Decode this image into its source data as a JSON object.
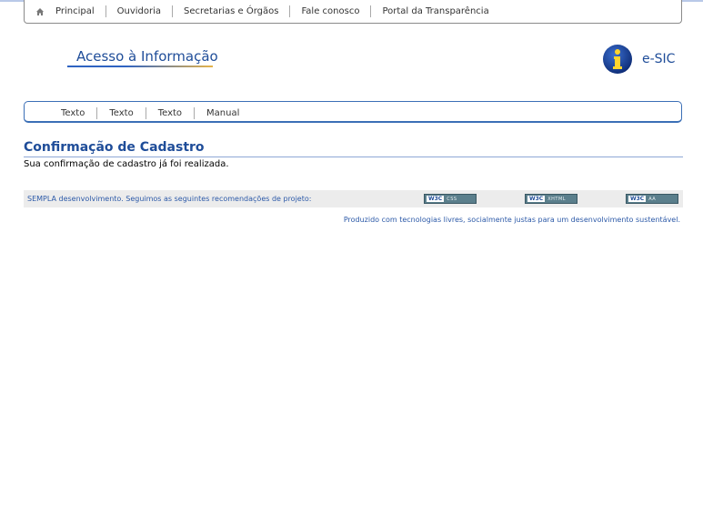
{
  "topnav": {
    "items": [
      "Principal",
      "Ouvidoria",
      "Secretarias e Órgãos",
      "Fale conosco",
      "Portal da Transparência"
    ]
  },
  "header": {
    "brand_title": "Acesso à Informação",
    "esic_label": "e-SIC"
  },
  "subnav": {
    "items": [
      "Texto",
      "Texto",
      "Texto",
      "Manual"
    ]
  },
  "content": {
    "title": "Confirmação de Cadastro",
    "message": "Sua confirmação de cadastro já foi realizada."
  },
  "footer": {
    "text": "SEMPLA desenvolvimento. Seguimos as seguintes recomendações de projeto:",
    "badges": [
      {
        "w3c": "W3C",
        "kind": "CSS"
      },
      {
        "w3c": "W3C",
        "kind": "XHTML"
      },
      {
        "w3c": "W3C",
        "kind": "AA"
      }
    ],
    "note": "Produzido com tecnologias livres, socialmente justas para um desenvolvimento sustentável."
  },
  "colors": {
    "accent": "#1f4d99",
    "link": "#2d5aa8",
    "footer_bg": "#ececec",
    "badge": "#5b7f8c"
  }
}
